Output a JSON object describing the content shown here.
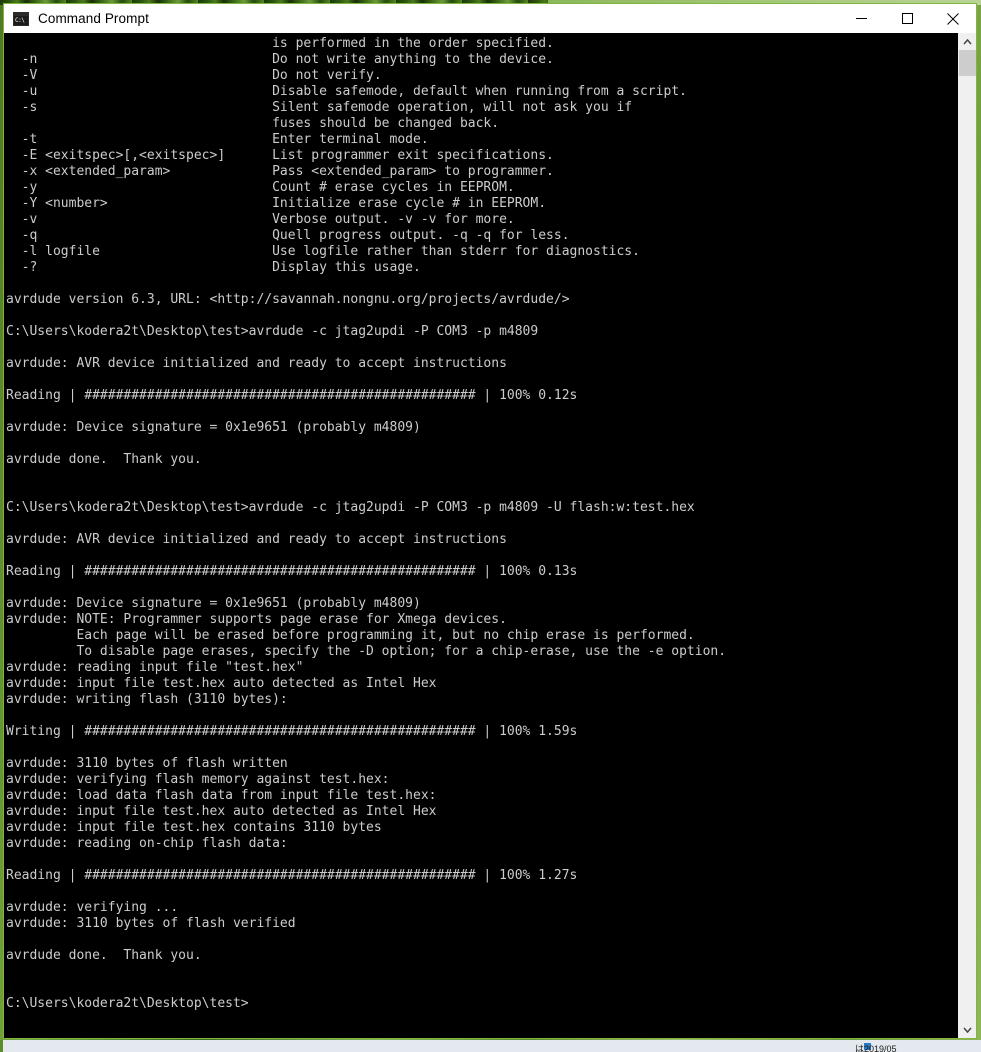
{
  "window": {
    "title": "Command Prompt",
    "app_icon": "cmd-icon",
    "controls": {
      "minimize": "minimize",
      "maximize": "maximize",
      "close": "close"
    },
    "border_color": "#7fb73e",
    "titlebar_bg": "#ffffff"
  },
  "desktop": {
    "background_color": "#6f9a3c"
  },
  "scrollbar": {
    "up_arrow": "scroll-up",
    "down_arrow": "scroll-down",
    "thumb_color": "#cdcdcd",
    "track_color": "#f0f0f0"
  },
  "taskbar_strip": {
    "visible_fragment": "は2019/05"
  },
  "console": {
    "foreground_color": "#cccccc",
    "background_color": "#000000",
    "text": "                                  is performed in the order specified.\n  -n                              Do not write anything to the device.\n  -V                              Do not verify.\n  -u                              Disable safemode, default when running from a script.\n  -s                              Silent safemode operation, will not ask you if\n                                  fuses should be changed back.\n  -t                              Enter terminal mode.\n  -E <exitspec>[,<exitspec>]      List programmer exit specifications.\n  -x <extended_param>             Pass <extended_param> to programmer.\n  -y                              Count # erase cycles in EEPROM.\n  -Y <number>                     Initialize erase cycle # in EEPROM.\n  -v                              Verbose output. -v -v for more.\n  -q                              Quell progress output. -q -q for less.\n  -l logfile                      Use logfile rather than stderr for diagnostics.\n  -?                              Display this usage.\n\navrdude version 6.3, URL: <http://savannah.nongnu.org/projects/avrdude/>\n\nC:\\Users\\kodera2t\\Desktop\\test>avrdude -c jtag2updi -P COM3 -p m4809\n\navrdude: AVR device initialized and ready to accept instructions\n\nReading | ################################################## | 100% 0.12s\n\navrdude: Device signature = 0x1e9651 (probably m4809)\n\navrdude done.  Thank you.\n\n\nC:\\Users\\kodera2t\\Desktop\\test>avrdude -c jtag2updi -P COM3 -p m4809 -U flash:w:test.hex\n\navrdude: AVR device initialized and ready to accept instructions\n\nReading | ################################################## | 100% 0.13s\n\navrdude: Device signature = 0x1e9651 (probably m4809)\navrdude: NOTE: Programmer supports page erase for Xmega devices.\n         Each page will be erased before programming it, but no chip erase is performed.\n         To disable page erases, specify the -D option; for a chip-erase, use the -e option.\navrdude: reading input file \"test.hex\"\navrdude: input file test.hex auto detected as Intel Hex\navrdude: writing flash (3110 bytes):\n\nWriting | ################################################## | 100% 1.59s\n\navrdude: 3110 bytes of flash written\navrdude: verifying flash memory against test.hex:\navrdude: load data flash data from input file test.hex:\navrdude: input file test.hex auto detected as Intel Hex\navrdude: input file test.hex contains 3110 bytes\navrdude: reading on-chip flash data:\n\nReading | ################################################## | 100% 1.27s\n\navrdude: verifying ...\navrdude: 3110 bytes of flash verified\n\navrdude done.  Thank you.\n\n\nC:\\Users\\kodera2t\\Desktop\\test>"
  }
}
